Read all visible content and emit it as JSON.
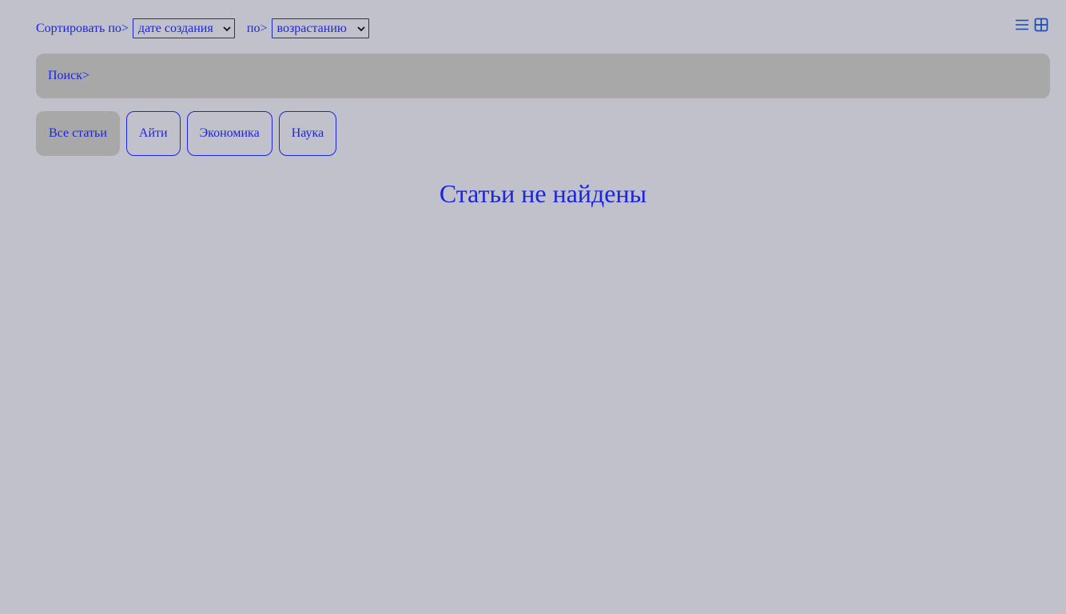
{
  "sort": {
    "label": "Сортировать по>",
    "field_selected": "дате создания",
    "order_label": "по>",
    "order_selected": "возрастанию"
  },
  "view_toggle": {
    "list_icon": "list-icon",
    "grid_icon": "grid-icon"
  },
  "search": {
    "placeholder": "Поиск>"
  },
  "categories": [
    {
      "label": "Все статьи",
      "active": true
    },
    {
      "label": "Айти",
      "active": false
    },
    {
      "label": "Экономика",
      "active": false
    },
    {
      "label": "Наука",
      "active": false
    }
  ],
  "empty_message": "Статьи не найдены",
  "colors": {
    "background": "#c1c1cb",
    "accent": "#1a25e0",
    "panel": "#a8a8a8",
    "icon": "#1f4fb5"
  }
}
